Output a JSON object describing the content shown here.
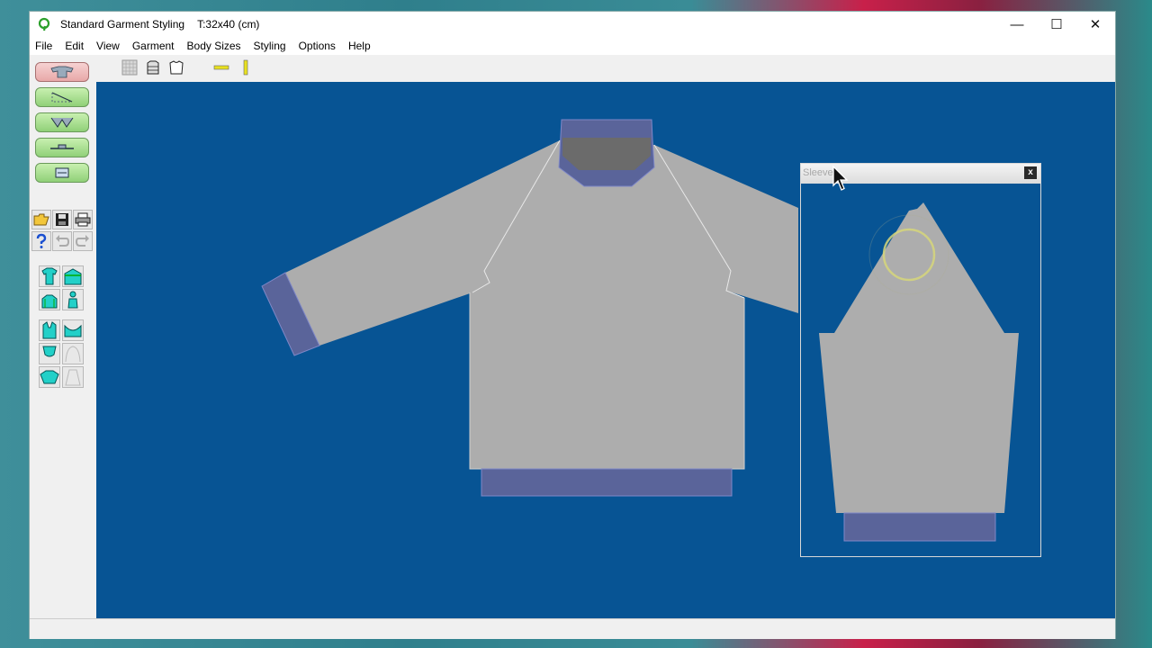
{
  "window": {
    "title": "Standard Garment Styling",
    "subtitle": "T:32x40  (cm)",
    "controls": {
      "minimize": "—",
      "maximize": "☐",
      "close": "✕"
    }
  },
  "menu": [
    "File",
    "Edit",
    "View",
    "Garment",
    "Body Sizes",
    "Styling",
    "Options",
    "Help"
  ],
  "toolbar": {
    "icons": [
      "grid-icon",
      "sweater-front-icon",
      "sweater-back-icon",
      "horizontal-ruler-icon",
      "vertical-ruler-icon"
    ]
  },
  "left_panel": {
    "mode_buttons": [
      "sweater-mode-icon",
      "measure-mode-icon",
      "shape-mode-icon",
      "align-mode-icon",
      "chart-mode-icon"
    ],
    "file_tools": [
      "open-folder-icon",
      "save-icon",
      "print-icon",
      "help-icon",
      "undo-icon",
      "redo-icon"
    ]
  },
  "sleeve_window": {
    "title": "Sleeve",
    "close": "x"
  },
  "colors": {
    "canvas": "#075494",
    "garment_body": "#adadad",
    "rib_trim": "#5a649a",
    "neck_inside": "#6b6b6b"
  }
}
